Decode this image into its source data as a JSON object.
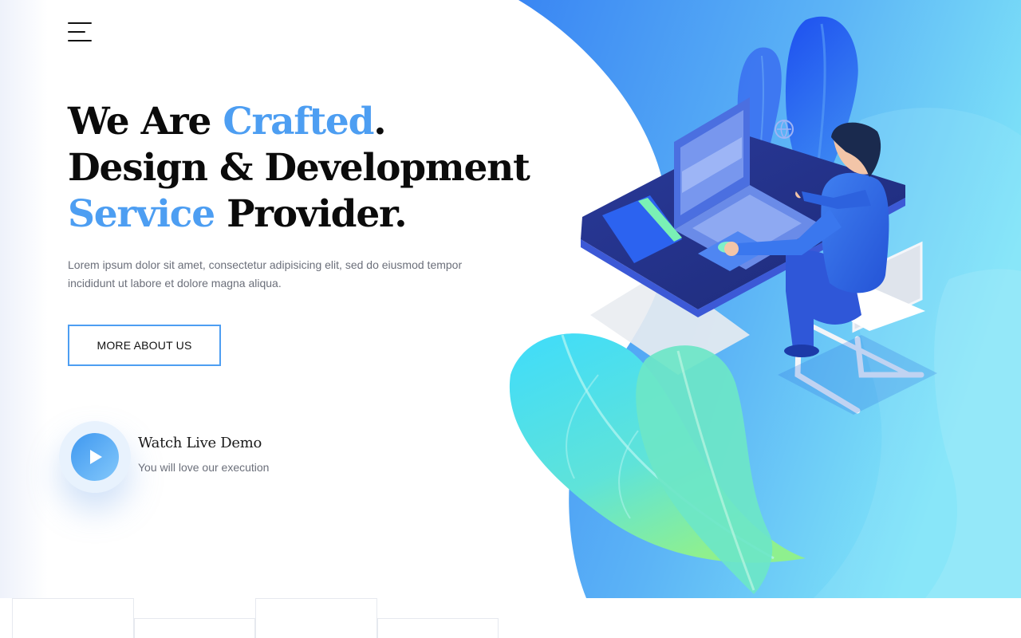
{
  "header": {
    "menu_icon": "hamburger-menu-icon"
  },
  "hero": {
    "headline": {
      "line1": {
        "prefix": "We Are ",
        "accent": "Crafted",
        "suffix": "."
      },
      "line2": "Design & Development",
      "line3": {
        "accent": "Service",
        "suffix": " Provider."
      }
    },
    "intro": "Lorem ipsum dolor sit amet, consectetur adipisicing elit, sed do eiusmod tempor incididunt ut labore et dolore magna aliqua.",
    "cta_label": "MORE ABOUT US",
    "demo": {
      "icon": "play-icon",
      "title": "Watch Live Demo",
      "subtitle": "You will love our execution"
    },
    "illustration": "person-working-at-laptop-illustration"
  },
  "colors": {
    "accent": "#4d9ef2",
    "headline": "#0b0b0b",
    "body_text": "#6b6f7a",
    "gradient_start": "#1f6df0",
    "gradient_end": "#7fe3f7"
  }
}
